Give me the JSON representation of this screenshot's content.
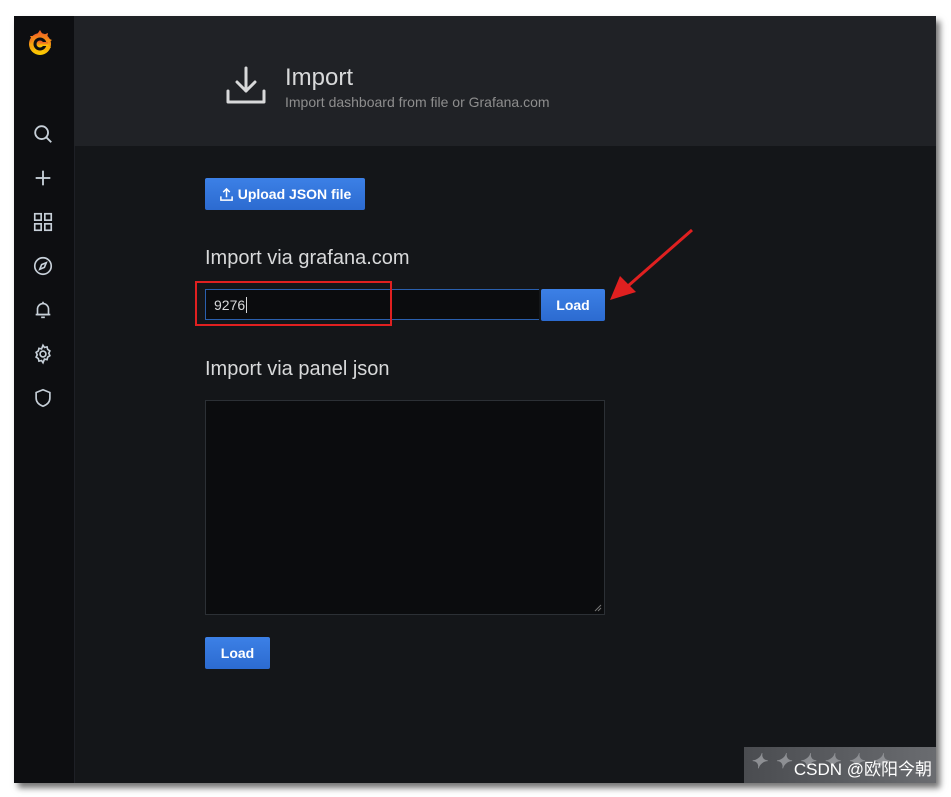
{
  "sidebar": {
    "logo": "grafana-logo",
    "items": [
      {
        "icon": "search-icon",
        "label": "Search"
      },
      {
        "icon": "plus-icon",
        "label": "Create"
      },
      {
        "icon": "dashboards-icon",
        "label": "Dashboards"
      },
      {
        "icon": "explore-icon",
        "label": "Explore"
      },
      {
        "icon": "bell-icon",
        "label": "Alerting"
      },
      {
        "icon": "gear-icon",
        "label": "Configuration"
      },
      {
        "icon": "shield-icon",
        "label": "Server Admin"
      }
    ]
  },
  "header": {
    "icon": "import-icon",
    "title": "Import",
    "subtitle": "Import dashboard from file or Grafana.com"
  },
  "upload": {
    "label": "Upload JSON file",
    "icon": "upload-icon"
  },
  "grafana_import": {
    "heading": "Import via grafana.com",
    "value": "9276",
    "load_label": "Load"
  },
  "panel_json": {
    "heading": "Import via panel json",
    "value": "",
    "load_label": "Load"
  },
  "colors": {
    "accent": "#3274d9",
    "highlight_box": "#e02020",
    "background": "#141619"
  },
  "watermark": {
    "text": "CSDN @欧阳今朝"
  }
}
